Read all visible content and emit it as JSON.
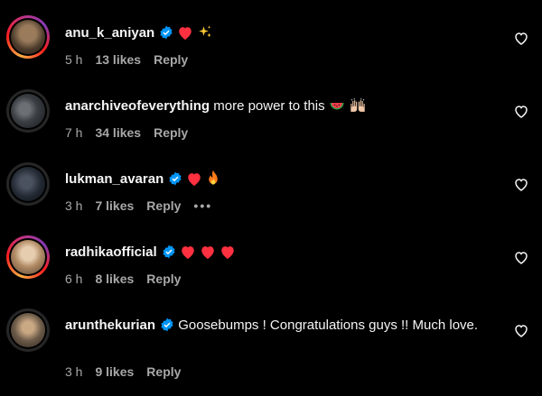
{
  "comments": [
    {
      "username": "anu_k_aniyan",
      "verified": true,
      "text": "",
      "emojis": [
        "heart",
        "sparkles"
      ],
      "time": "5 h",
      "likes": "13 likes",
      "reply": "Reply",
      "more": "",
      "ring": true,
      "avatar_color": "#5a4a3a"
    },
    {
      "username": "anarchiveofeverything",
      "verified": false,
      "text": "more power to this",
      "emojis": [
        "watermelon",
        "raising-hands"
      ],
      "time": "7 h",
      "likes": "34 likes",
      "reply": "Reply",
      "more": "",
      "ring": false,
      "avatar_color": "#3b3f44"
    },
    {
      "username": "lukman_avaran",
      "verified": true,
      "text": "",
      "emojis": [
        "heart",
        "fire"
      ],
      "time": "3 h",
      "likes": "7 likes",
      "reply": "Reply",
      "more": "•••",
      "ring": false,
      "avatar_color": "#222831"
    },
    {
      "username": "radhikaofficial",
      "verified": true,
      "text": "",
      "emojis": [
        "heart",
        "heart",
        "heart"
      ],
      "time": "6 h",
      "likes": "8 likes",
      "reply": "Reply",
      "more": "",
      "ring": true,
      "avatar_color": "#c9a27a"
    },
    {
      "username": "arunthekurian",
      "verified": true,
      "text": "Goosebumps ! Congratulations guys !! Much love.",
      "emojis": [],
      "time": "3 h",
      "likes": "9 likes",
      "reply": "Reply",
      "more": "",
      "ring": false,
      "avatar_color": "#6b5a48"
    }
  ],
  "colors": {
    "background": "#000000",
    "meta_text": "#a8a8a8",
    "verified": "#0095f6",
    "heart": "#ff3040"
  }
}
